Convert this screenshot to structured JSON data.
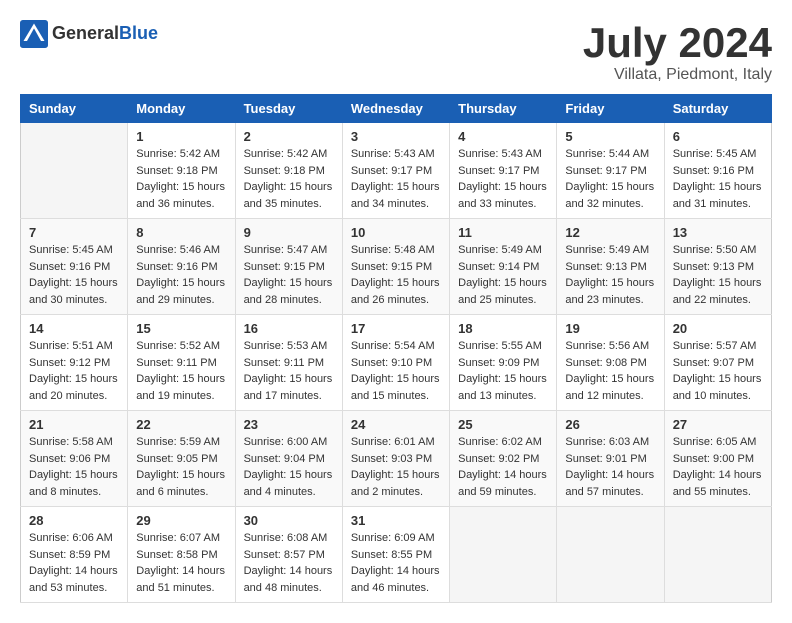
{
  "header": {
    "logo_general": "General",
    "logo_blue": "Blue",
    "month_year": "July 2024",
    "location": "Villata, Piedmont, Italy"
  },
  "days_of_week": [
    "Sunday",
    "Monday",
    "Tuesday",
    "Wednesday",
    "Thursday",
    "Friday",
    "Saturday"
  ],
  "weeks": [
    [
      {
        "day": "",
        "content": ""
      },
      {
        "day": "1",
        "content": "Sunrise: 5:42 AM\nSunset: 9:18 PM\nDaylight: 15 hours\nand 36 minutes."
      },
      {
        "day": "2",
        "content": "Sunrise: 5:42 AM\nSunset: 9:18 PM\nDaylight: 15 hours\nand 35 minutes."
      },
      {
        "day": "3",
        "content": "Sunrise: 5:43 AM\nSunset: 9:17 PM\nDaylight: 15 hours\nand 34 minutes."
      },
      {
        "day": "4",
        "content": "Sunrise: 5:43 AM\nSunset: 9:17 PM\nDaylight: 15 hours\nand 33 minutes."
      },
      {
        "day": "5",
        "content": "Sunrise: 5:44 AM\nSunset: 9:17 PM\nDaylight: 15 hours\nand 32 minutes."
      },
      {
        "day": "6",
        "content": "Sunrise: 5:45 AM\nSunset: 9:16 PM\nDaylight: 15 hours\nand 31 minutes."
      }
    ],
    [
      {
        "day": "7",
        "content": "Sunrise: 5:45 AM\nSunset: 9:16 PM\nDaylight: 15 hours\nand 30 minutes."
      },
      {
        "day": "8",
        "content": "Sunrise: 5:46 AM\nSunset: 9:16 PM\nDaylight: 15 hours\nand 29 minutes."
      },
      {
        "day": "9",
        "content": "Sunrise: 5:47 AM\nSunset: 9:15 PM\nDaylight: 15 hours\nand 28 minutes."
      },
      {
        "day": "10",
        "content": "Sunrise: 5:48 AM\nSunset: 9:15 PM\nDaylight: 15 hours\nand 26 minutes."
      },
      {
        "day": "11",
        "content": "Sunrise: 5:49 AM\nSunset: 9:14 PM\nDaylight: 15 hours\nand 25 minutes."
      },
      {
        "day": "12",
        "content": "Sunrise: 5:49 AM\nSunset: 9:13 PM\nDaylight: 15 hours\nand 23 minutes."
      },
      {
        "day": "13",
        "content": "Sunrise: 5:50 AM\nSunset: 9:13 PM\nDaylight: 15 hours\nand 22 minutes."
      }
    ],
    [
      {
        "day": "14",
        "content": "Sunrise: 5:51 AM\nSunset: 9:12 PM\nDaylight: 15 hours\nand 20 minutes."
      },
      {
        "day": "15",
        "content": "Sunrise: 5:52 AM\nSunset: 9:11 PM\nDaylight: 15 hours\nand 19 minutes."
      },
      {
        "day": "16",
        "content": "Sunrise: 5:53 AM\nSunset: 9:11 PM\nDaylight: 15 hours\nand 17 minutes."
      },
      {
        "day": "17",
        "content": "Sunrise: 5:54 AM\nSunset: 9:10 PM\nDaylight: 15 hours\nand 15 minutes."
      },
      {
        "day": "18",
        "content": "Sunrise: 5:55 AM\nSunset: 9:09 PM\nDaylight: 15 hours\nand 13 minutes."
      },
      {
        "day": "19",
        "content": "Sunrise: 5:56 AM\nSunset: 9:08 PM\nDaylight: 15 hours\nand 12 minutes."
      },
      {
        "day": "20",
        "content": "Sunrise: 5:57 AM\nSunset: 9:07 PM\nDaylight: 15 hours\nand 10 minutes."
      }
    ],
    [
      {
        "day": "21",
        "content": "Sunrise: 5:58 AM\nSunset: 9:06 PM\nDaylight: 15 hours\nand 8 minutes."
      },
      {
        "day": "22",
        "content": "Sunrise: 5:59 AM\nSunset: 9:05 PM\nDaylight: 15 hours\nand 6 minutes."
      },
      {
        "day": "23",
        "content": "Sunrise: 6:00 AM\nSunset: 9:04 PM\nDaylight: 15 hours\nand 4 minutes."
      },
      {
        "day": "24",
        "content": "Sunrise: 6:01 AM\nSunset: 9:03 PM\nDaylight: 15 hours\nand 2 minutes."
      },
      {
        "day": "25",
        "content": "Sunrise: 6:02 AM\nSunset: 9:02 PM\nDaylight: 14 hours\nand 59 minutes."
      },
      {
        "day": "26",
        "content": "Sunrise: 6:03 AM\nSunset: 9:01 PM\nDaylight: 14 hours\nand 57 minutes."
      },
      {
        "day": "27",
        "content": "Sunrise: 6:05 AM\nSunset: 9:00 PM\nDaylight: 14 hours\nand 55 minutes."
      }
    ],
    [
      {
        "day": "28",
        "content": "Sunrise: 6:06 AM\nSunset: 8:59 PM\nDaylight: 14 hours\nand 53 minutes."
      },
      {
        "day": "29",
        "content": "Sunrise: 6:07 AM\nSunset: 8:58 PM\nDaylight: 14 hours\nand 51 minutes."
      },
      {
        "day": "30",
        "content": "Sunrise: 6:08 AM\nSunset: 8:57 PM\nDaylight: 14 hours\nand 48 minutes."
      },
      {
        "day": "31",
        "content": "Sunrise: 6:09 AM\nSunset: 8:55 PM\nDaylight: 14 hours\nand 46 minutes."
      },
      {
        "day": "",
        "content": ""
      },
      {
        "day": "",
        "content": ""
      },
      {
        "day": "",
        "content": ""
      }
    ]
  ]
}
